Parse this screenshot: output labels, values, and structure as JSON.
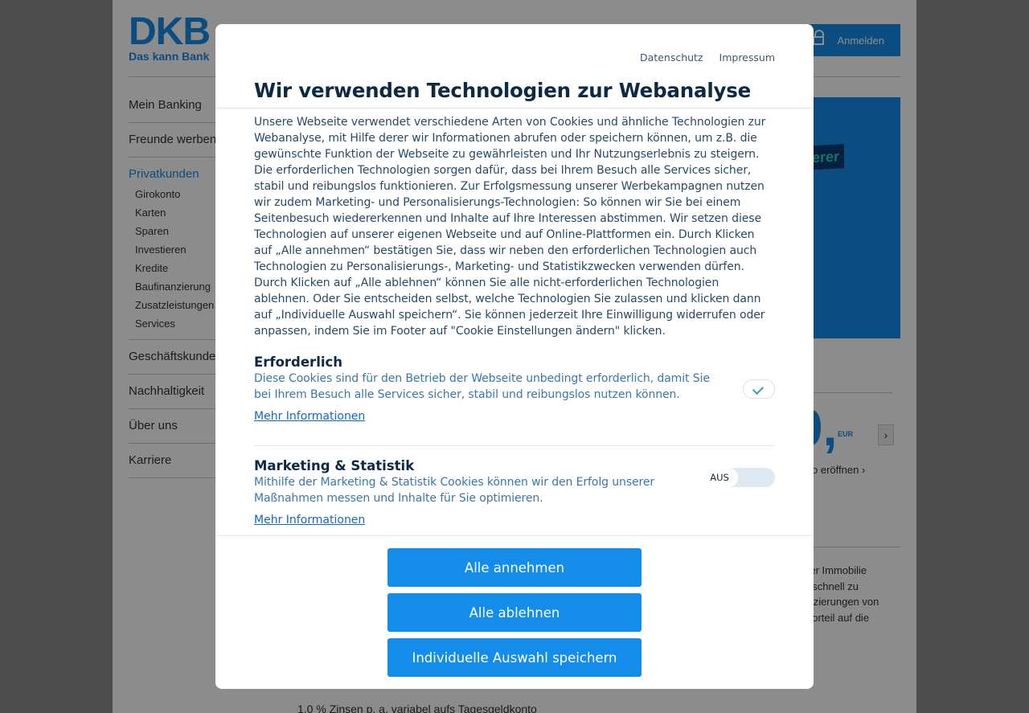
{
  "page": {
    "logo_main": "DKB",
    "logo_sub": "Das kann Bank",
    "login_label": "Anmelden",
    "nav": {
      "items_top": [
        "Mein Banking",
        "Freunde werben"
      ],
      "active": "Privatkunden",
      "subitems": [
        "Girokonto",
        "Karten",
        "Sparen",
        "Investieren",
        "Kredite",
        "Baufinanzierung",
        "Zusatzleistungen",
        "Services"
      ],
      "items_bottom": [
        "Geschäftskunden",
        "Nachhaltigkeit",
        "Über uns",
        "Karriere"
      ]
    },
    "banner_tag": "erer",
    "big_value": "0,",
    "currency": "EUR",
    "open_link": "o eröffnen",
    "body_lines": [
      "einer Immobilie",
      "ich schnell zu",
      "nanzierungen von",
      "nsvorteil auf die"
    ],
    "bottom_text": "1,0 % Zinsen p. a. variabel aufs Tagesgeldkonto"
  },
  "modal": {
    "links": [
      "Datenschutz",
      "Impressum"
    ],
    "title": "Wir verwenden Technologien zur Webanalyse",
    "intro": "Unsere Webseite verwendet verschiedene Arten von Cookies und ähnliche Technologien zur Webanalyse, mit Hilfe derer wir Informationen abrufen oder speichern können, um z.B. die gewünschte Funktion der Webseite zu gewährleisten und Ihr Nutzungserlebnis zu steigern. Die erforderlichen Technologien sorgen dafür, dass bei Ihrem Besuch alle Services sicher, stabil und reibungslos funktionieren. Zur Erfolgsmessung unserer Werbekampagnen nutzen wir zudem Marketing- und Personalisierungs-Technologien: So können wir Sie bei einem Seitenbesuch wiedererkennen und Inhalte auf Ihre Interessen abstimmen. Wir setzen diese Technologien auf unserer eigenen Webseite und auf Online-Plattformen ein. Durch Klicken auf „Alle annehmen“ bestätigen Sie, dass wir neben den erforderlichen Technologien auch Technologien zu Personalisierungs-, Marketing- und Statistikzwecken verwenden dürfen. Durch Klicken auf „Alle ablehnen“ können Sie alle nicht-erforderlichen Technologien ablehnen. Oder Sie entscheiden selbst, welche Technologien Sie zulassen und klicken dann auf „Individuelle Auswahl speichern“. Sie können jederzeit Ihre Einwilligung widerrufen oder anpassen, indem Sie im Footer auf \"Cookie Einstellungen ändern\" klicken.",
    "sections": [
      {
        "title": "Erforderlich",
        "desc": "Diese Cookies sind für den Betrieb der Webseite unbedingt erforderlich, damit Sie bei Ihrem Besuch alle Services sicher, stabil und reibungslos nutzen können.",
        "more": "Mehr Informationen",
        "toggle": "checked"
      },
      {
        "title": "Marketing & Statistik",
        "desc": "Mithilfe der Marketing & Statistik Cookies können wir den Erfolg unserer Maßnahmen messen und Inhalte für Sie optimieren.",
        "more": "Mehr Informationen",
        "toggle_label": "AUS"
      }
    ],
    "buttons": {
      "accept_all": "Alle annehmen",
      "reject_all": "Alle ablehnen",
      "save_selection": "Individuelle Auswahl speichern"
    }
  },
  "colors": {
    "brand_blue": "#148dea",
    "title_navy": "#0d2a45",
    "link_blue": "#1268c0"
  }
}
